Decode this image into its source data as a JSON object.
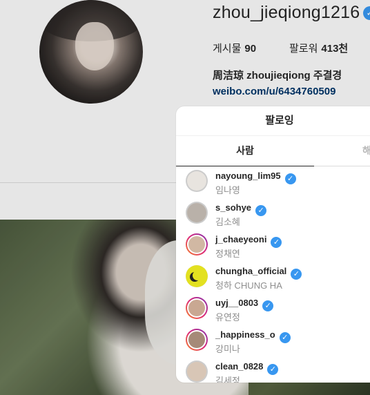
{
  "profile": {
    "username": "zhou_jieqiong1216",
    "verified_icon": "verified-badge-icon",
    "posts_label": "게시물",
    "posts_value": "90",
    "followers_label": "팔로워",
    "followers_value": "413천",
    "full_name": "周洁琼 zhoujieqiong 주결경",
    "website": "weibo.com/u/6434760509"
  },
  "modal": {
    "title": "팔로잉",
    "tabs": [
      {
        "label": "사람"
      },
      {
        "label": "해"
      }
    ],
    "accent_color": "#3897f0",
    "following": [
      {
        "username": "nayoung_lim95",
        "full_name": "임나영",
        "verified": true,
        "avatar_color": "#e8e4df"
      },
      {
        "username": "s_sohye",
        "full_name": "김소혜",
        "verified": true,
        "avatar_color": "#b9b1a9"
      },
      {
        "username": "j_chaeyeoni",
        "full_name": "정채연",
        "verified": true,
        "avatar_color": "#d1b8a3"
      },
      {
        "username": "chungha_official",
        "full_name": "청하 CHUNG HA",
        "verified": true,
        "avatar_color": "#e3e120"
      },
      {
        "username": "uyj__0803",
        "full_name": "유연정",
        "verified": true,
        "avatar_color": "#c9a892"
      },
      {
        "username": "_happiness_o",
        "full_name": "강미나",
        "verified": true,
        "avatar_color": "#a68a78"
      },
      {
        "username": "clean_0828",
        "full_name": "김세정",
        "verified": true,
        "avatar_color": "#d8c6b6"
      }
    ]
  }
}
